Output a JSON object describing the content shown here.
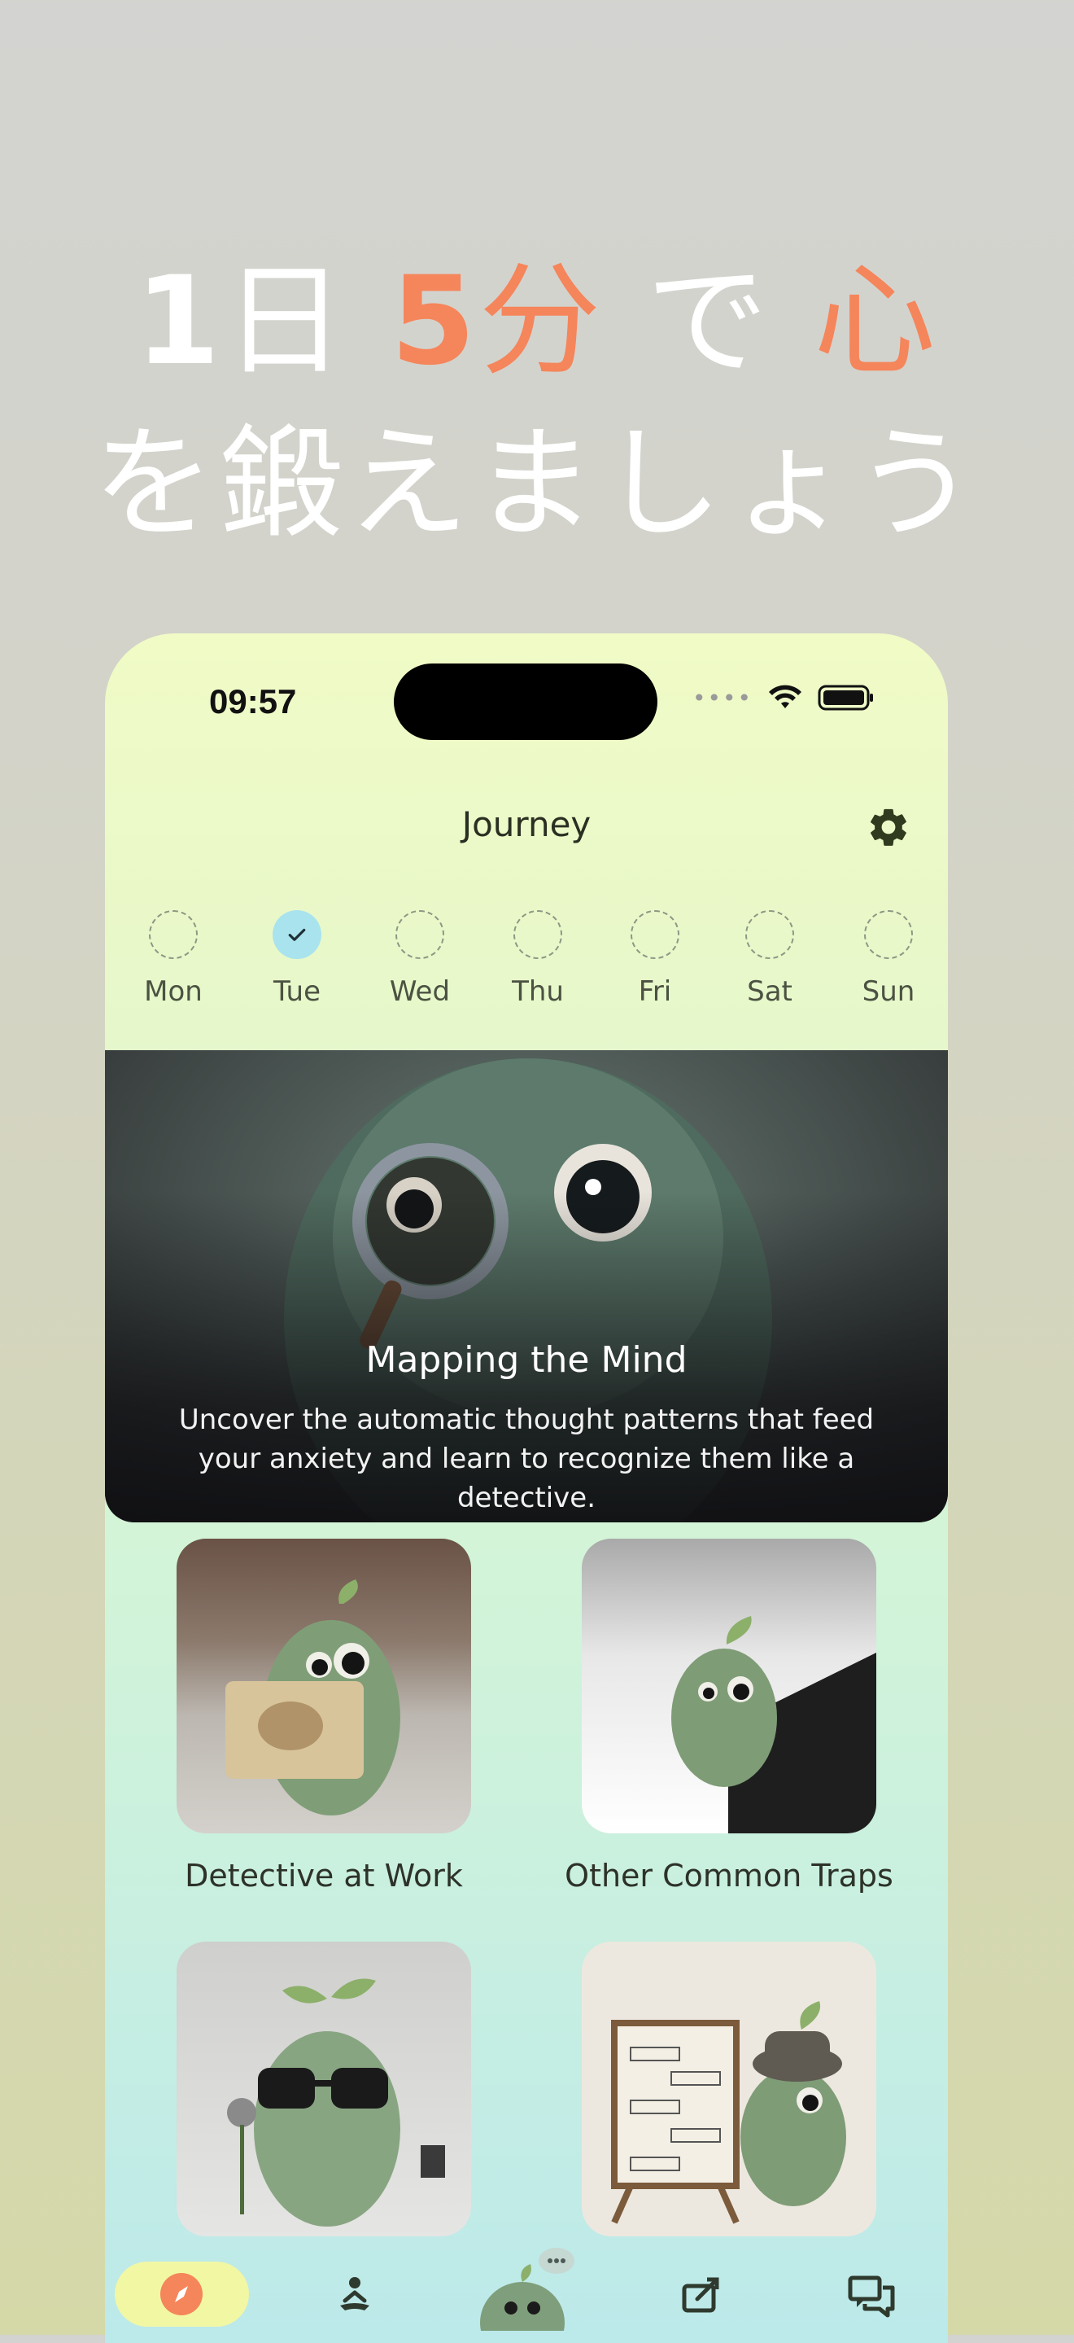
{
  "headline": {
    "line1_num": "1",
    "line1_day": "日",
    "line1_five": "5",
    "line1_min": "分",
    "line1_de": "で",
    "line1_heart": "心",
    "line2": "を鍛えましょう"
  },
  "status_bar": {
    "time": "09:57"
  },
  "header": {
    "title": "Journey"
  },
  "week": {
    "days": [
      {
        "label": "Mon",
        "done": false
      },
      {
        "label": "Tue",
        "done": true
      },
      {
        "label": "Wed",
        "done": false
      },
      {
        "label": "Thu",
        "done": false
      },
      {
        "label": "Fri",
        "done": false
      },
      {
        "label": "Sat",
        "done": false
      },
      {
        "label": "Sun",
        "done": false
      }
    ]
  },
  "hero": {
    "title": "Mapping the Mind",
    "description": "Uncover the automatic thought patterns that feed your anxiety and learn to recognize them like a detective."
  },
  "cards": [
    {
      "label": "Detective at Work"
    },
    {
      "label": "Other Common Traps"
    },
    {
      "label": ""
    },
    {
      "label": ""
    }
  ],
  "colors": {
    "accent": "#f5855a",
    "active_tab": "#f2f7a4",
    "done_day": "#a8e3ee"
  },
  "tabs": [
    {
      "icon": "compass-icon",
      "active": true
    },
    {
      "icon": "meditation-icon",
      "active": false
    },
    {
      "icon": "mascot-chat-icon",
      "active": false
    },
    {
      "icon": "journal-icon",
      "active": false
    },
    {
      "icon": "chat-bubbles-icon",
      "active": false
    }
  ]
}
